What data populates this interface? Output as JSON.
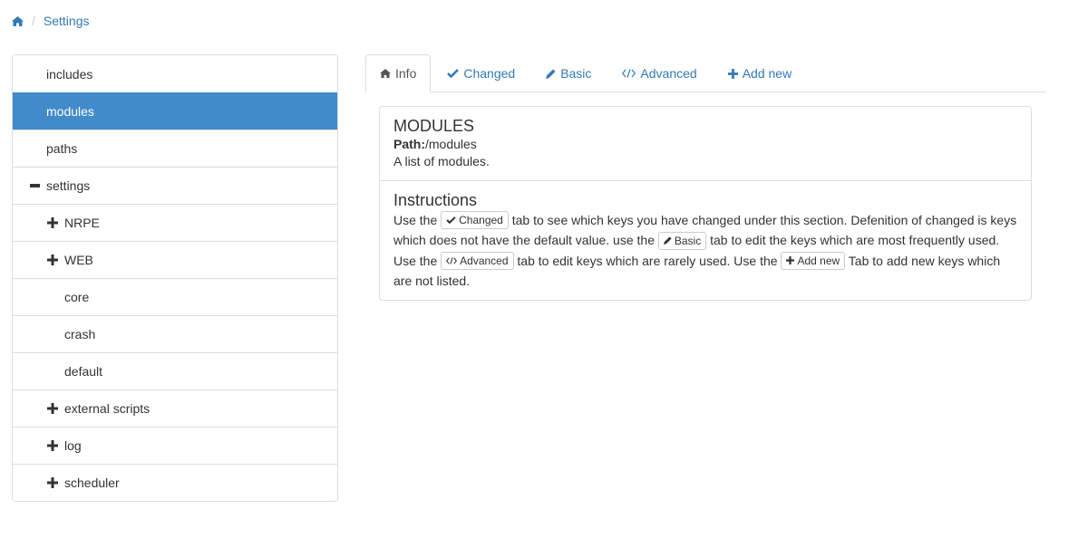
{
  "breadcrumb": {
    "home_icon": "home-icon",
    "separator": "/",
    "current": "Settings"
  },
  "tree": {
    "items": [
      {
        "label": "includes",
        "level": 0,
        "toggle": "none",
        "active": false
      },
      {
        "label": "modules",
        "level": 0,
        "toggle": "none",
        "active": true
      },
      {
        "label": "paths",
        "level": 0,
        "toggle": "none",
        "active": false
      },
      {
        "label": "settings",
        "level": 0,
        "toggle": "minus-icon",
        "active": false
      },
      {
        "label": "NRPE",
        "level": 1,
        "toggle": "plus-icon",
        "active": false
      },
      {
        "label": "WEB",
        "level": 1,
        "toggle": "plus-icon",
        "active": false
      },
      {
        "label": "core",
        "level": 1,
        "toggle": "none",
        "active": false
      },
      {
        "label": "crash",
        "level": 1,
        "toggle": "none",
        "active": false
      },
      {
        "label": "default",
        "level": 1,
        "toggle": "none",
        "active": false
      },
      {
        "label": "external scripts",
        "level": 1,
        "toggle": "plus-icon",
        "active": false
      },
      {
        "label": "log",
        "level": 1,
        "toggle": "plus-icon",
        "active": false
      },
      {
        "label": "scheduler",
        "level": 1,
        "toggle": "plus-icon",
        "active": false
      }
    ]
  },
  "tabs": [
    {
      "label": "Info",
      "icon": "home-icon",
      "active": true
    },
    {
      "label": "Changed",
      "icon": "check-icon",
      "active": false
    },
    {
      "label": "Basic",
      "icon": "pencil-icon",
      "active": false
    },
    {
      "label": "Advanced",
      "icon": "code-icon",
      "active": false
    },
    {
      "label": "Add new",
      "icon": "plus-icon",
      "active": false
    }
  ],
  "info": {
    "title": "MODULES",
    "path_label": "Path:",
    "path_value": "/modules",
    "description": "A list of modules."
  },
  "instructions": {
    "title": "Instructions",
    "t1": "Use the ",
    "b1": "Changed",
    "t2": " tab to see which keys you have changed under this section. Defenition of changed is keys which does not have the default value. use the ",
    "b2": "Basic",
    "t3": " tab to edit the keys which are most frequently used. Use the ",
    "b3": "Advanced",
    "t4": " tab to edit keys which are rarely used. Use the ",
    "b4": "Add new",
    "t5": " Tab to add new keys which are not listed."
  },
  "colors": {
    "link": "#337ab7",
    "active_bg": "#428bca",
    "border": "#dddddd"
  }
}
